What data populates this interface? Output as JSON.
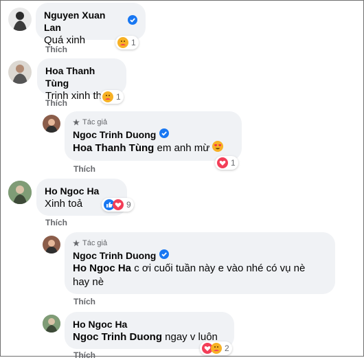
{
  "comments": [
    {
      "author": "Nguyen Xuan Lan",
      "text": "Quá xinh",
      "like_label": "Thích",
      "reaction_count": "1"
    },
    {
      "author": "Hoa Thanh Tùng",
      "text": "Trinh xinh thế",
      "like_label": "Thích",
      "reaction_count": "1"
    },
    {
      "badge": "Tác giả",
      "author": "Ngoc Trinh Duong",
      "mention": "Hoa Thanh Tùng",
      "text": "em anh mừ",
      "like_label": "Thích",
      "reaction_count": "1"
    },
    {
      "author": "Ho Ngoc Ha",
      "text": "Xinh toả",
      "like_label": "Thích",
      "reaction_count": "9"
    },
    {
      "badge": "Tác giả",
      "author": "Ngoc Trinh Duong",
      "mention": "Ho Ngoc Ha",
      "text": "c ơi cuối tuần này e vào nhé có vụ nè",
      "text_line2": "hay nè",
      "like_label": "Thích"
    },
    {
      "author": "Ho Ngoc Ha",
      "mention": "Ngoc Trinh Duong",
      "text": "ngay v luôn",
      "like_label": "Thích",
      "reaction_count": "2"
    }
  ],
  "colors": {
    "bubble": "#f0f2f5",
    "verified": "#1877f2",
    "muted": "#65676b"
  },
  "icons": [
    "verified-badge-icon",
    "author-badge-icon",
    "care-reaction-icon",
    "like-reaction-icon",
    "love-reaction-icon",
    "heart-eyes-emoji-icon"
  ]
}
